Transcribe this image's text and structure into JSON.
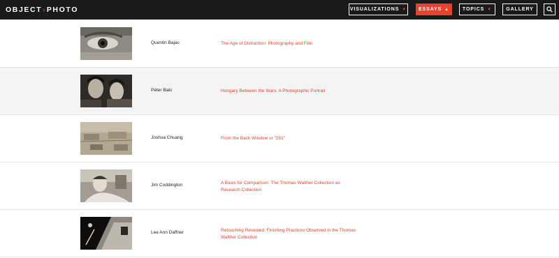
{
  "header": {
    "logo_left": "OBJECT",
    "logo_right": "PHOTO",
    "nav": [
      {
        "label": "VISUALIZATIONS",
        "active": false
      },
      {
        "label": "ESSAYS",
        "active": true
      },
      {
        "label": "TOPICS",
        "active": false
      },
      {
        "label": "GALLERY",
        "active": false
      }
    ],
    "search_icon": "search-icon"
  },
  "essays": [
    {
      "author": "Quentin Bajac",
      "title": "The Age of Distraction: Photography and Film"
    },
    {
      "author": "Péter Baki",
      "title": "Hungary Between the Wars: A Photographic Portrait"
    },
    {
      "author": "Joshua Chuang",
      "title": "From the Back Window or \"291\""
    },
    {
      "author": "Jim Coddington",
      "title": "A Basis for Comparison: The Thomas Walther Collection as Research Collection"
    },
    {
      "author": "Lee Ann Daffner",
      "title": "Retouching Revealed: Finishing Practices Observed in the Thomas Walther Collection"
    }
  ],
  "colors": {
    "accent": "#e8412c",
    "header_bg": "#1a1a1a",
    "row_alt": "#f4f4f4"
  }
}
